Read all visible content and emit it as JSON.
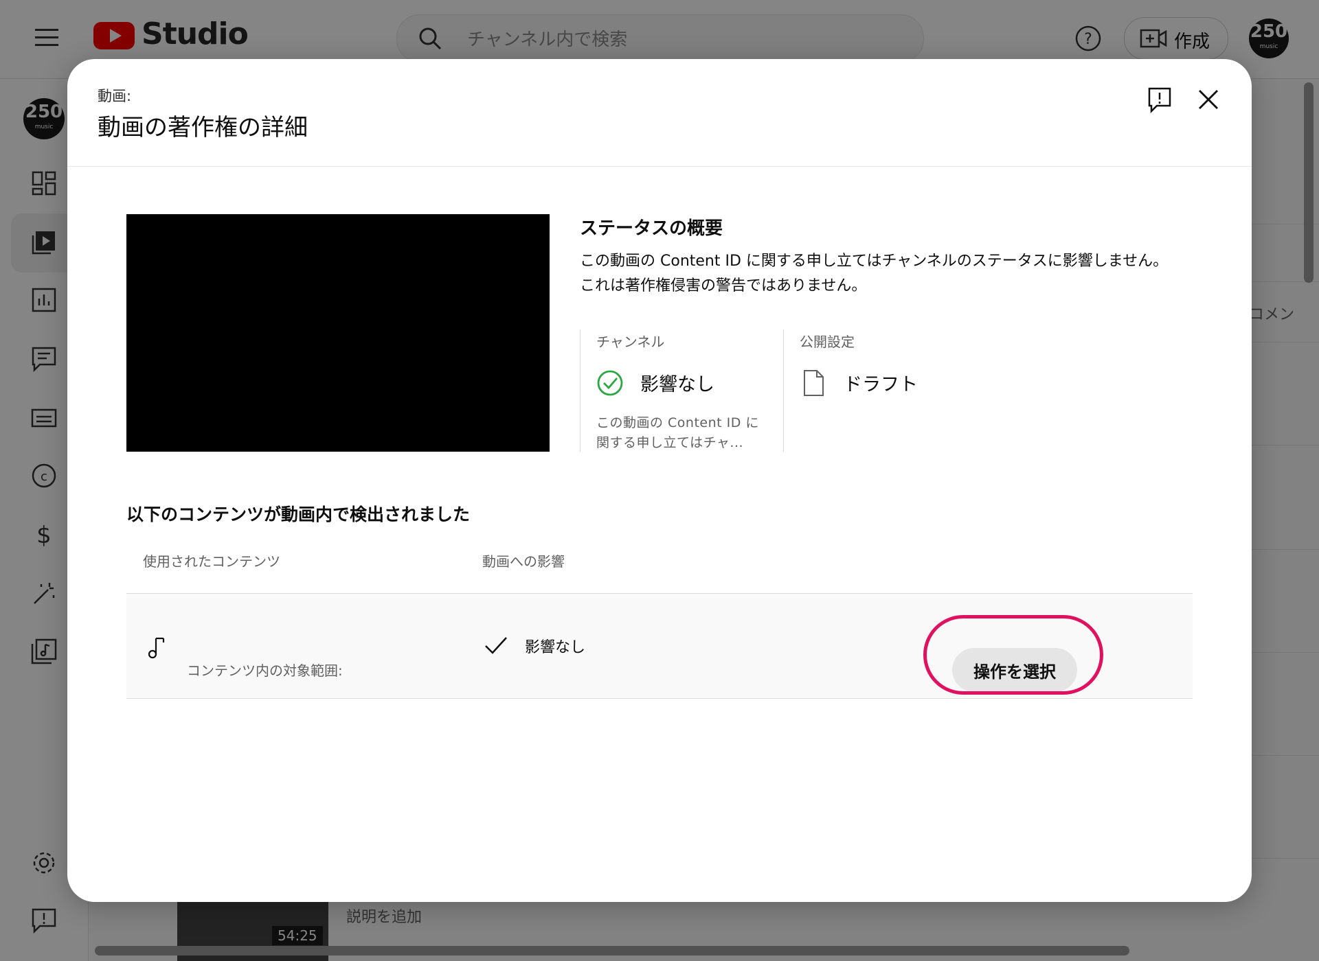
{
  "header": {
    "logo_text": "Studio",
    "search_placeholder": "チャンネル内で検索",
    "create_label": "作成",
    "avatar": {
      "number": "250",
      "subtext": "music"
    }
  },
  "background": {
    "side_text": "コメン",
    "description_placeholder": "説明を追加",
    "video_duration": "54:25"
  },
  "dialog": {
    "kicker": "動画:",
    "title": "動画の著作権の詳細",
    "status": {
      "title": "ステータスの概要",
      "description_line1": "この動画の Content ID に関する申し立てはチャンネルのステータスに影響しません。",
      "description_line2": "これは著作権侵害の警告ではありません。",
      "channel_label": "チャンネル",
      "channel_value": "影響なし",
      "channel_sub": "この動画の Content ID に関する申し立てはチャ...",
      "visibility_label": "公開設定",
      "visibility_value": "ドラフト"
    },
    "detected": {
      "title": "以下のコンテンツが動画内で検出されました",
      "col_content": "使用されたコンテンツ",
      "col_impact": "動画への影響",
      "rows": [
        {
          "scope_label": "コンテンツ内の対象範囲:",
          "impact": "影響なし",
          "action_label": "操作を選択"
        }
      ]
    }
  },
  "colors": {
    "accent_red": "#ff0000",
    "annotation": "#e0115f",
    "success_green": "#2ba640"
  }
}
